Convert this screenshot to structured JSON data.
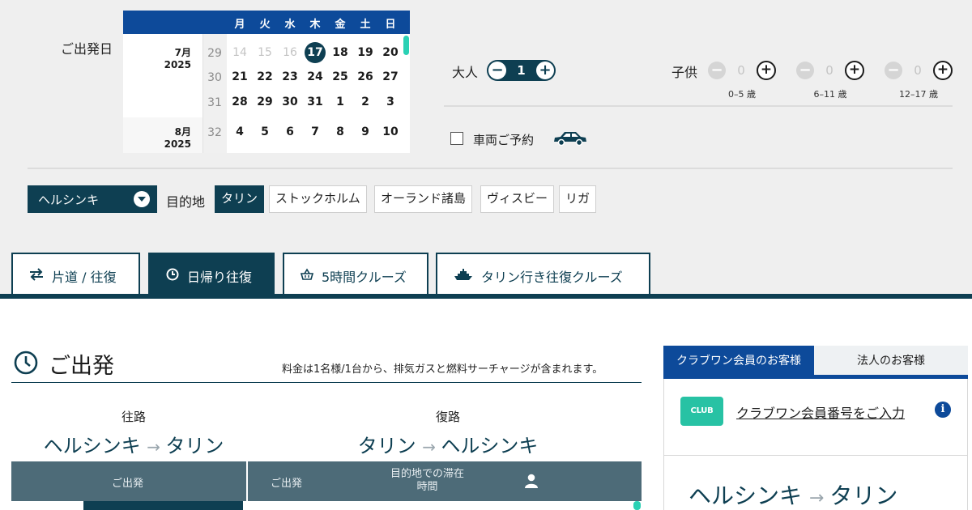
{
  "search": {
    "departure_label": "ご出発日",
    "calendar": {
      "weekdays": [
        "月",
        "火",
        "水",
        "木",
        "金",
        "土",
        "日"
      ],
      "months": [
        {
          "month": "7月",
          "year": "2025"
        },
        {
          "month": "8月",
          "year": "2025"
        }
      ],
      "weeks": [
        {
          "week": "29",
          "days": [
            "14",
            "15",
            "16",
            "17",
            "18",
            "19",
            "20"
          ]
        },
        {
          "week": "30",
          "days": [
            "21",
            "22",
            "23",
            "24",
            "25",
            "26",
            "27"
          ]
        },
        {
          "week": "31",
          "days": [
            "28",
            "29",
            "30",
            "31",
            "1",
            "2",
            "3"
          ]
        },
        {
          "week": "32",
          "days": [
            "4",
            "5",
            "6",
            "7",
            "8",
            "9",
            "10"
          ]
        }
      ],
      "selected_day": "17"
    },
    "adults": {
      "label": "大人",
      "value": "1"
    },
    "children": {
      "label": "子供",
      "groups": [
        {
          "value": "0",
          "age": "0–5 歳"
        },
        {
          "value": "0",
          "age": "6–11 歳"
        },
        {
          "value": "0",
          "age": "12–17 歳"
        }
      ]
    },
    "vehicle_label": "車両ご予約",
    "origin": "ヘルシンキ",
    "destination_label": "目的地",
    "destinations": [
      "タリン",
      "ストックホルム",
      "オーランド諸島",
      "ヴィスビー",
      "リガ"
    ],
    "active_destination": "タリン"
  },
  "trip_tabs": [
    {
      "label": "片道 / 往復",
      "icon": "swap-arrows-icon"
    },
    {
      "label": "日帰り往復",
      "icon": "clock-icon"
    },
    {
      "label": "5時間クルーズ",
      "icon": "basket-icon"
    },
    {
      "label": "タリン行き往復クルーズ",
      "icon": "ship-icon"
    }
  ],
  "active_tab": "日帰り往復",
  "results": {
    "title": "ご出発",
    "fare_note": "料金は1名様/1台から、排気ガスと燃料サーチャージが含まれます。",
    "outbound": {
      "label": "往路",
      "from": "ヘルシンキ",
      "to": "タリン"
    },
    "return": {
      "label": "復路",
      "from": "タリン",
      "to": "ヘルシンキ"
    },
    "columns": {
      "outbound_departure": "ご出発",
      "return_departure": "ご出発",
      "stay_line1": "目的地での滞在",
      "stay_line2": "時間"
    }
  },
  "sidebar": {
    "tabs": [
      "クラブワン会員のお客様",
      "法人のお客様"
    ],
    "logo_text": "CLUB ONE",
    "member_link": "クラブワン会員番号をご入力",
    "route": {
      "from": "ヘルシンキ",
      "to": "タリン"
    }
  },
  "colors": {
    "navy": "#0e3f52",
    "blue": "#0d4a9a",
    "teal": "#27c2a4",
    "slate": "#4d6b78"
  }
}
